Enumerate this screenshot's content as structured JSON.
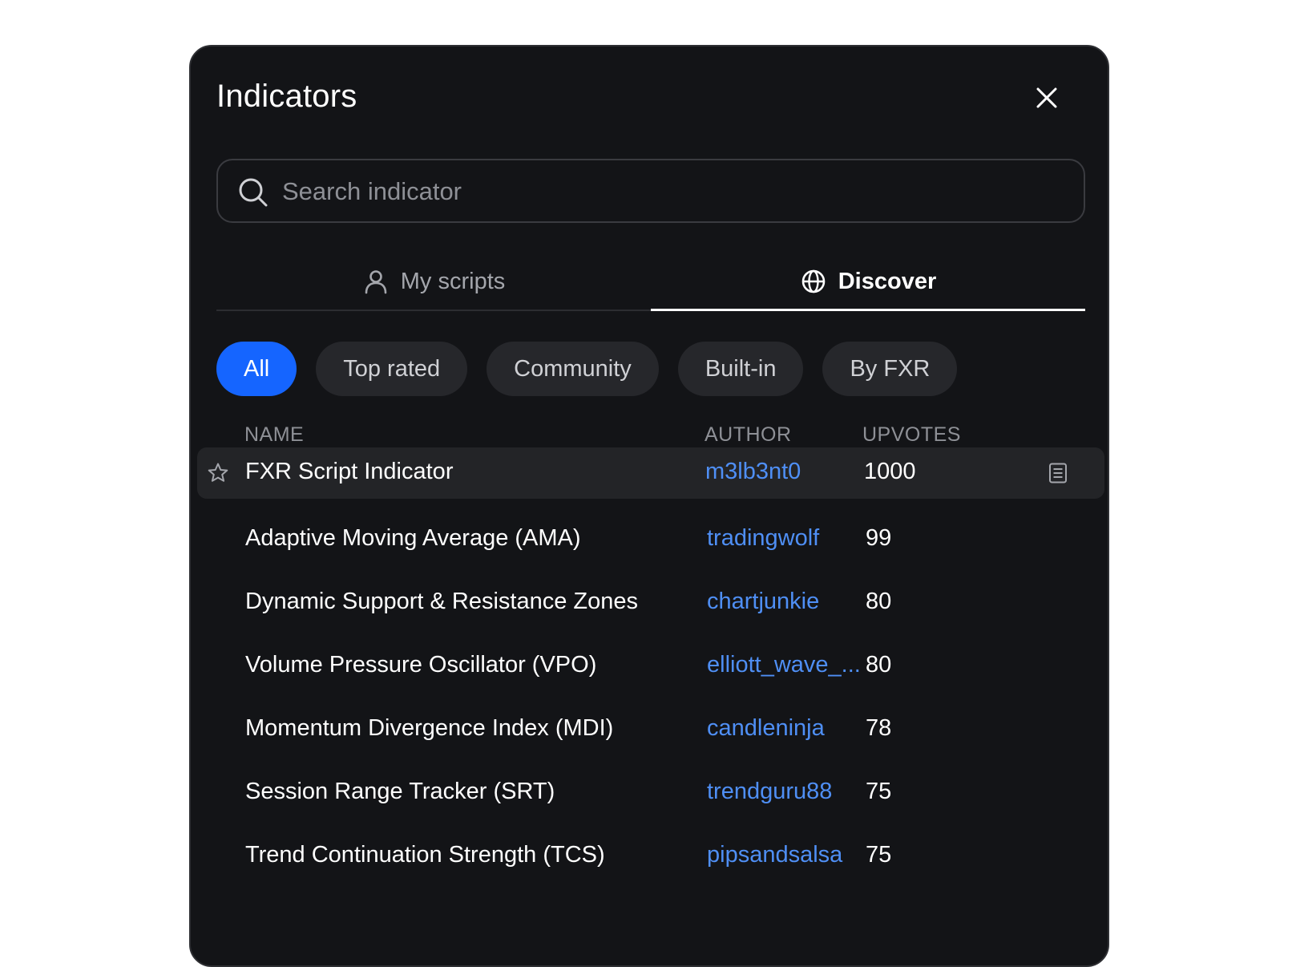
{
  "dialog": {
    "title": "Indicators"
  },
  "search": {
    "placeholder": "Search indicator",
    "value": ""
  },
  "tabs": [
    {
      "label": "My scripts",
      "icon": "user-icon",
      "active": false
    },
    {
      "label": "Discover",
      "icon": "globe-icon",
      "active": true
    }
  ],
  "filters": [
    {
      "label": "All",
      "selected": true
    },
    {
      "label": "Top rated",
      "selected": false
    },
    {
      "label": "Community",
      "selected": false
    },
    {
      "label": "Built-in",
      "selected": false
    },
    {
      "label": "By FXR",
      "selected": false
    }
  ],
  "table": {
    "headers": {
      "name": "NAME",
      "author": "AUTHOR",
      "upvotes": "UPVOTES"
    },
    "rows": [
      {
        "name": "FXR Script Indicator",
        "author": "m3lb3nt0",
        "upvotes": "1000",
        "highlighted": true
      },
      {
        "name": "Adaptive Moving Average (AMA)",
        "author": "tradingwolf",
        "upvotes": "99"
      },
      {
        "name": "Dynamic Support & Resistance Zones",
        "author": "chartjunkie",
        "upvotes": "80"
      },
      {
        "name": "Volume Pressure Oscillator (VPO)",
        "author": "elliott_wave_...",
        "upvotes": "80"
      },
      {
        "name": "Momentum Divergence Index (MDI)",
        "author": "candleninja",
        "upvotes": "78"
      },
      {
        "name": "Session Range Tracker (SRT)",
        "author": "trendguru88",
        "upvotes": "75"
      },
      {
        "name": "Trend Continuation Strength (TCS)",
        "author": "pipsandsalsa",
        "upvotes": "75"
      }
    ]
  },
  "colors": {
    "background": "#131417",
    "accent": "#1565ff",
    "author_link": "#4f8ff5",
    "chip": "#26272b"
  }
}
